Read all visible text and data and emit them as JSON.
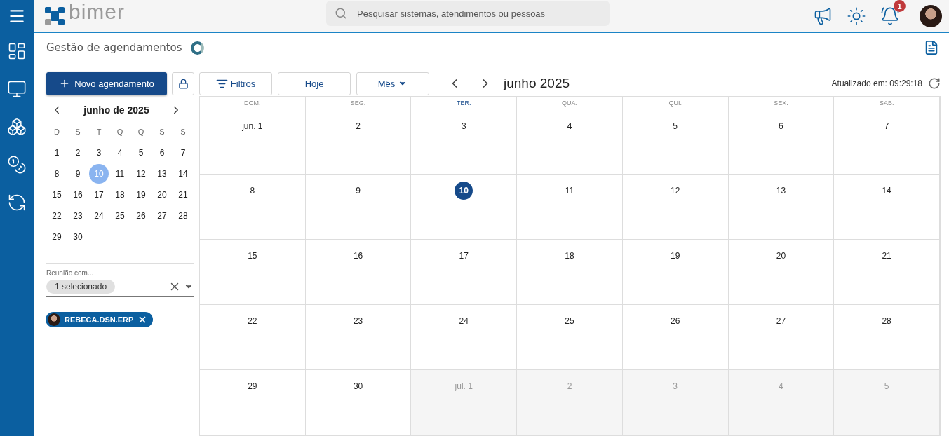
{
  "header": {
    "logo": "bimer",
    "search": {
      "placeholder": "Pesquisar sistemas, atendimentos ou pessoas"
    },
    "notification_count": "1"
  },
  "page": {
    "title": "Gestão de agendamentos"
  },
  "toolbar": {
    "new_button": "Novo agendamento",
    "filters_button": "Filtros",
    "today_button": "Hoje",
    "view_select": "Mês",
    "period": "junho 2025",
    "updated": "Atualizado em: 09:29:18"
  },
  "mini_calendar": {
    "title": "junho de 2025",
    "weekdays": [
      "D",
      "S",
      "T",
      "Q",
      "Q",
      "S",
      "S"
    ],
    "days": [
      {
        "label": "1",
        "selected": false
      },
      {
        "label": "2",
        "selected": false
      },
      {
        "label": "3",
        "selected": false
      },
      {
        "label": "4",
        "selected": false
      },
      {
        "label": "5",
        "selected": false
      },
      {
        "label": "6",
        "selected": false
      },
      {
        "label": "7",
        "selected": false
      },
      {
        "label": "8",
        "selected": false
      },
      {
        "label": "9",
        "selected": false
      },
      {
        "label": "10",
        "selected": true
      },
      {
        "label": "11",
        "selected": false
      },
      {
        "label": "12",
        "selected": false
      },
      {
        "label": "13",
        "selected": false
      },
      {
        "label": "14",
        "selected": false
      },
      {
        "label": "15",
        "selected": false
      },
      {
        "label": "16",
        "selected": false
      },
      {
        "label": "17",
        "selected": false
      },
      {
        "label": "18",
        "selected": false
      },
      {
        "label": "19",
        "selected": false
      },
      {
        "label": "20",
        "selected": false
      },
      {
        "label": "21",
        "selected": false
      },
      {
        "label": "22",
        "selected": false
      },
      {
        "label": "23",
        "selected": false
      },
      {
        "label": "24",
        "selected": false
      },
      {
        "label": "25",
        "selected": false
      },
      {
        "label": "26",
        "selected": false
      },
      {
        "label": "27",
        "selected": false
      },
      {
        "label": "28",
        "selected": false
      },
      {
        "label": "29",
        "selected": false
      },
      {
        "label": "30",
        "selected": false
      }
    ]
  },
  "filter": {
    "label": "Reunião com...",
    "chip": "1 selecionado",
    "people": [
      "REBECA.DSN.ERP"
    ]
  },
  "calendar": {
    "weekdays": [
      {
        "label": "DOM.",
        "today": false
      },
      {
        "label": "SEG.",
        "today": false
      },
      {
        "label": "TER.",
        "today": true
      },
      {
        "label": "QUA.",
        "today": false
      },
      {
        "label": "QUI.",
        "today": false
      },
      {
        "label": "SEX.",
        "today": false
      },
      {
        "label": "SÁB.",
        "today": false
      }
    ],
    "weeks": [
      [
        {
          "label": "jun. 1",
          "outside": false,
          "today": false
        },
        {
          "label": "2",
          "outside": false,
          "today": false
        },
        {
          "label": "3",
          "outside": false,
          "today": false
        },
        {
          "label": "4",
          "outside": false,
          "today": false
        },
        {
          "label": "5",
          "outside": false,
          "today": false
        },
        {
          "label": "6",
          "outside": false,
          "today": false
        },
        {
          "label": "7",
          "outside": false,
          "today": false
        }
      ],
      [
        {
          "label": "8",
          "outside": false,
          "today": false
        },
        {
          "label": "9",
          "outside": false,
          "today": false
        },
        {
          "label": "10",
          "outside": false,
          "today": true
        },
        {
          "label": "11",
          "outside": false,
          "today": false
        },
        {
          "label": "12",
          "outside": false,
          "today": false
        },
        {
          "label": "13",
          "outside": false,
          "today": false
        },
        {
          "label": "14",
          "outside": false,
          "today": false
        }
      ],
      [
        {
          "label": "15",
          "outside": false,
          "today": false
        },
        {
          "label": "16",
          "outside": false,
          "today": false
        },
        {
          "label": "17",
          "outside": false,
          "today": false
        },
        {
          "label": "18",
          "outside": false,
          "today": false
        },
        {
          "label": "19",
          "outside": false,
          "today": false
        },
        {
          "label": "20",
          "outside": false,
          "today": false
        },
        {
          "label": "21",
          "outside": false,
          "today": false
        }
      ],
      [
        {
          "label": "22",
          "outside": false,
          "today": false
        },
        {
          "label": "23",
          "outside": false,
          "today": false
        },
        {
          "label": "24",
          "outside": false,
          "today": false
        },
        {
          "label": "25",
          "outside": false,
          "today": false
        },
        {
          "label": "26",
          "outside": false,
          "today": false
        },
        {
          "label": "27",
          "outside": false,
          "today": false
        },
        {
          "label": "28",
          "outside": false,
          "today": false
        }
      ],
      [
        {
          "label": "29",
          "outside": false,
          "today": false
        },
        {
          "label": "30",
          "outside": false,
          "today": false
        },
        {
          "label": "jul. 1",
          "outside": true,
          "today": false
        },
        {
          "label": "2",
          "outside": true,
          "today": false
        },
        {
          "label": "3",
          "outside": true,
          "today": false
        },
        {
          "label": "4",
          "outside": true,
          "today": false
        },
        {
          "label": "5",
          "outside": true,
          "today": false
        }
      ]
    ]
  }
}
